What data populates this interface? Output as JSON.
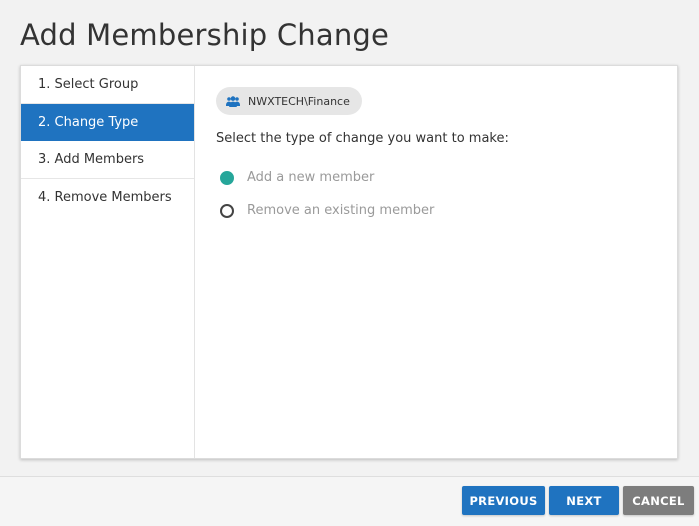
{
  "page": {
    "title": "Add Membership Change"
  },
  "steps": [
    {
      "label": "1. Select Group",
      "active": false
    },
    {
      "label": "2. Change Type",
      "active": true
    },
    {
      "label": "3. Add Members",
      "active": false
    },
    {
      "label": "4. Remove Members",
      "active": false
    }
  ],
  "content": {
    "group_chip": {
      "icon": "users-icon",
      "label": "NWXTECH\\Finance"
    },
    "prompt": "Select the type of change you want to make:",
    "options": [
      {
        "label": "Add a new member",
        "selected": true
      },
      {
        "label": "Remove an existing member",
        "selected": false
      }
    ]
  },
  "footer": {
    "previous_label": "PREVIOUS",
    "next_label": "NEXT",
    "cancel_label": "CANCEL"
  },
  "colors": {
    "primary": "#1f73c0",
    "selected_radio": "#26a69a",
    "cancel": "#7d7d7d",
    "chip_bg": "#e6e6e6",
    "users_icon": "#1f73c0"
  }
}
